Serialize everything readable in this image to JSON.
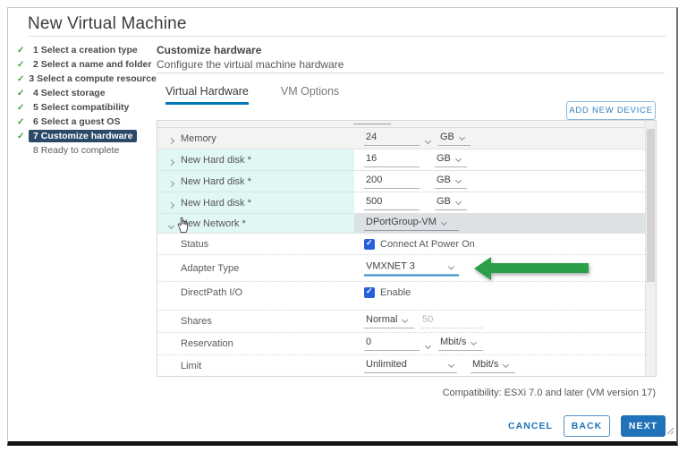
{
  "window": {
    "title": "New Virtual Machine"
  },
  "icons": {
    "check": "✓"
  },
  "sidebar": {
    "steps": [
      {
        "label": "1 Select a creation type",
        "checked": true,
        "active": false
      },
      {
        "label": "2 Select a name and folder",
        "checked": true,
        "active": false
      },
      {
        "label": "3 Select a compute resource",
        "checked": true,
        "active": false
      },
      {
        "label": "4 Select storage",
        "checked": true,
        "active": false
      },
      {
        "label": "5 Select compatibility",
        "checked": true,
        "active": false
      },
      {
        "label": "6 Select a guest OS",
        "checked": true,
        "active": false
      },
      {
        "label": "7 Customize hardware",
        "checked": true,
        "active": true
      },
      {
        "label": "8 Ready to complete",
        "checked": false,
        "active": false
      }
    ]
  },
  "content": {
    "heading": "Customize hardware",
    "subheading": "Configure the virtual machine hardware",
    "tabs": {
      "virtual_hardware": "Virtual Hardware",
      "vm_options": "VM Options"
    },
    "add_device_button": "ADD NEW DEVICE"
  },
  "hardware_table": {
    "memory": {
      "label": "Memory",
      "value": "24",
      "unit": "GB"
    },
    "disk1": {
      "label": "New Hard disk *",
      "value": "16",
      "unit": "GB"
    },
    "disk2": {
      "label": "New Hard disk *",
      "value": "200",
      "unit": "GB"
    },
    "disk3": {
      "label": "New Hard disk *",
      "value": "500",
      "unit": "GB"
    },
    "network": {
      "label": "New Network *",
      "value": "DPortGroup-VM"
    },
    "status": {
      "label": "Status",
      "checkbox_label": "Connect At Power On",
      "checked": true
    },
    "adapter_type": {
      "label": "Adapter Type",
      "value": "VMXNET 3"
    },
    "directpath": {
      "label": "DirectPath I/O",
      "checkbox_label": "Enable",
      "checked": true
    },
    "shares": {
      "label": "Shares",
      "value": "Normal",
      "amount": "50"
    },
    "reservation": {
      "label": "Reservation",
      "value": "0",
      "unit": "Mbit/s"
    },
    "limit": {
      "label": "Limit",
      "value": "Unlimited",
      "unit": "Mbit/s"
    }
  },
  "footer": {
    "compatibility": "Compatibility: ESXi 7.0 and later (VM version 17)",
    "cancel_label": "CANCEL",
    "back_label": "BACK",
    "next_label": "NEXT"
  },
  "colors": {
    "accent_blue": "#1b72b8",
    "tab_underline": "#0079b8",
    "active_step_bg": "#2a4a68",
    "check_green": "#3fa142",
    "arrow_green": "#2d9e49",
    "checkbox_blue": "#2b5fd8",
    "disk_row_cyan": "#e0f7f5",
    "selected_row_gray": "#dce1e5"
  }
}
